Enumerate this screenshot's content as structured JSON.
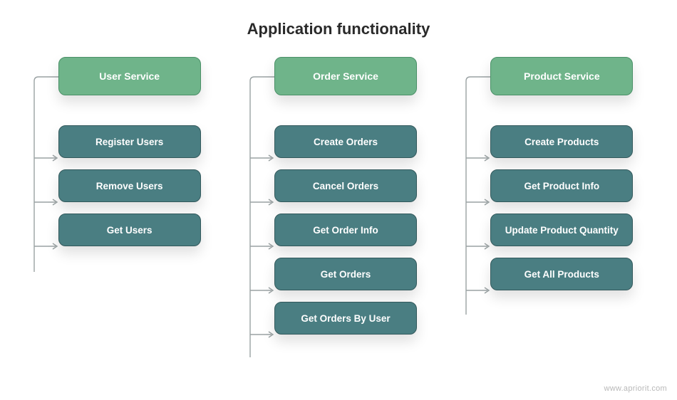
{
  "title": "Application functionality",
  "footer": "www.apriorit.com",
  "colors": {
    "service_bg": "#6fb48a",
    "service_border": "#4a9067",
    "child_bg": "#4a7e82",
    "child_border": "#33595c",
    "connector": "#9aa2a3"
  },
  "columns": [
    {
      "service": "User Service",
      "children": [
        "Register Users",
        "Remove Users",
        "Get Users"
      ]
    },
    {
      "service": "Order Service",
      "children": [
        "Create Orders",
        "Cancel Orders",
        "Get Order Info",
        "Get Orders",
        "Get Orders By User"
      ]
    },
    {
      "service": "Product Service",
      "children": [
        "Create Products",
        "Get Product Info",
        "Update Product Quantity",
        "Get All Products"
      ]
    }
  ]
}
